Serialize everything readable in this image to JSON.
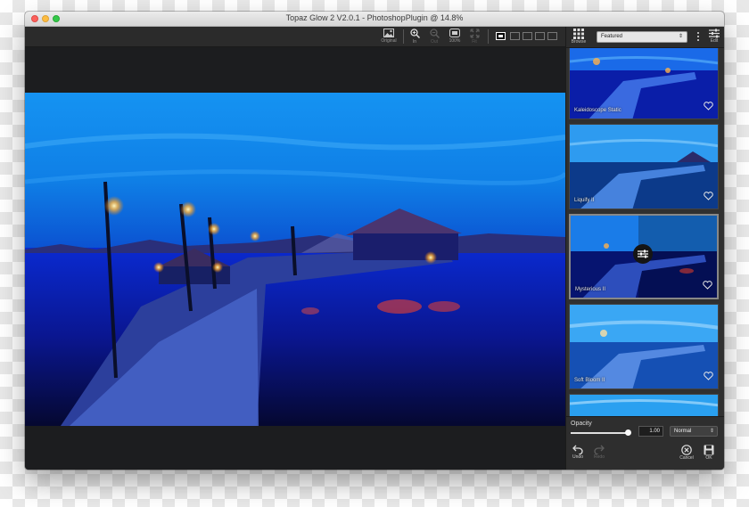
{
  "window": {
    "title": "Topaz Glow 2 V2.0.1 - PhotoshopPlugin @ 14.8%"
  },
  "toolbar": {
    "original_label": "Original",
    "zoom_in_label": "In",
    "zoom_out_label": "Out",
    "zoom_100_label": "100%",
    "fit_label": "Fit"
  },
  "panel": {
    "browse_label": "Browse",
    "category_selected": "Featured",
    "edit_label": "Edit"
  },
  "presets": [
    {
      "name": "Kaleidoscope Static",
      "selected": false
    },
    {
      "name": "Liquify II",
      "selected": false
    },
    {
      "name": "Mysterious II",
      "selected": true
    },
    {
      "name": "Soft Bloom II",
      "selected": false
    }
  ],
  "opacity": {
    "label": "Opacity",
    "value": "1.00",
    "fraction": 1.0,
    "blend_mode": "Normal"
  },
  "actions": {
    "undo_label": "Undo",
    "redo_label": "Redo",
    "cancel_label": "Cancel",
    "ok_label": "OK"
  },
  "colors": {
    "accent": "#1f8fff",
    "panel_bg": "#303030"
  }
}
